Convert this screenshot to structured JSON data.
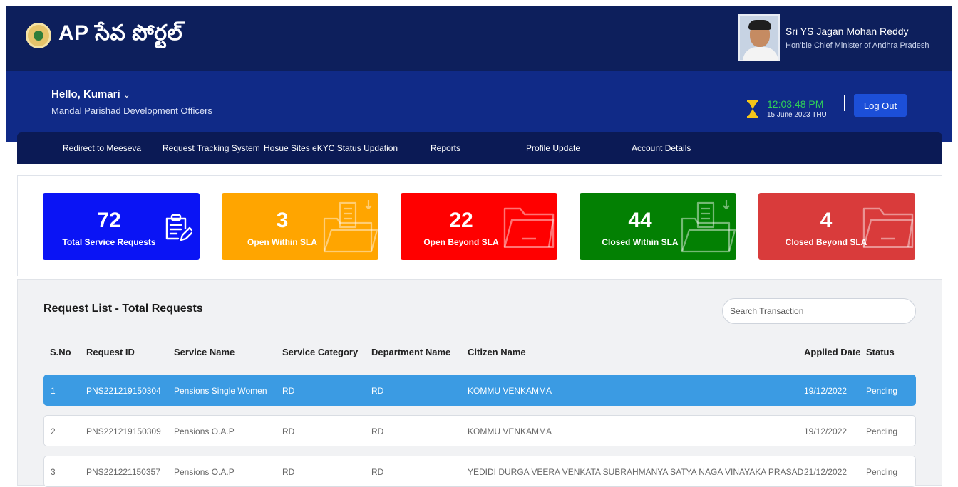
{
  "header": {
    "brand": "AP సేవ పోర్టల్",
    "leader_name": "Sri YS Jagan Mohan Reddy",
    "leader_title": "Hon'ble Chief Minister of Andhra Pradesh"
  },
  "user": {
    "greeting": "Hello, Kumari",
    "role": "Mandal Parishad Development Officers",
    "time": "12:03:48 PM",
    "date": "15 June 2023 THU",
    "logout_label": "Log Out"
  },
  "nav": [
    "Redirect to Meeseva",
    "Request Tracking System",
    "Hosue Sites eKYC Status Updation",
    "Reports",
    "Profile Update",
    "Account Details"
  ],
  "cards": [
    {
      "value": "72",
      "label": "Total Service Requests",
      "color": "#0a14f5",
      "icon": "document-edit-icon"
    },
    {
      "value": "3",
      "label": "Open Within SLA",
      "color": "#ffa500",
      "icon": "folder-download-icon"
    },
    {
      "value": "22",
      "label": "Open Beyond SLA",
      "color": "#ff0000",
      "icon": "open-folder-icon"
    },
    {
      "value": "44",
      "label": "Closed Within SLA",
      "color": "#038003",
      "icon": "folder-download-icon"
    },
    {
      "value": "4",
      "label": "Closed Beyond SLA",
      "color": "#d93b3b",
      "icon": "open-folder-icon"
    }
  ],
  "list": {
    "title": "Request List - Total Requests",
    "search_placeholder": "Search Transaction",
    "columns": [
      "S.No",
      "Request ID",
      "Service Name",
      "Service Category",
      "Department Name",
      "Citizen Name",
      "Applied Date",
      "Status"
    ],
    "rows": [
      [
        "1",
        "PNS221219150304",
        "Pensions Single Women",
        "RD",
        "RD",
        "KOMMU VENKAMMA",
        "19/12/2022",
        "Pending"
      ],
      [
        "2",
        "PNS221219150309",
        "Pensions O.A.P",
        "RD",
        "RD",
        "KOMMU VENKAMMA",
        "19/12/2022",
        "Pending"
      ],
      [
        "3",
        "PNS221221150357",
        "Pensions O.A.P",
        "RD",
        "RD",
        "YEDIDI DURGA VEERA VENKATA SUBRAHMANYA SATYA NAGA VINAYAKA PRASAD",
        "21/12/2022",
        "Pending"
      ]
    ]
  },
  "colors": {
    "header": "#0d1f5c",
    "band": "#102a87",
    "nav": "#0b1a55",
    "selected_row": "#3b9be3"
  }
}
